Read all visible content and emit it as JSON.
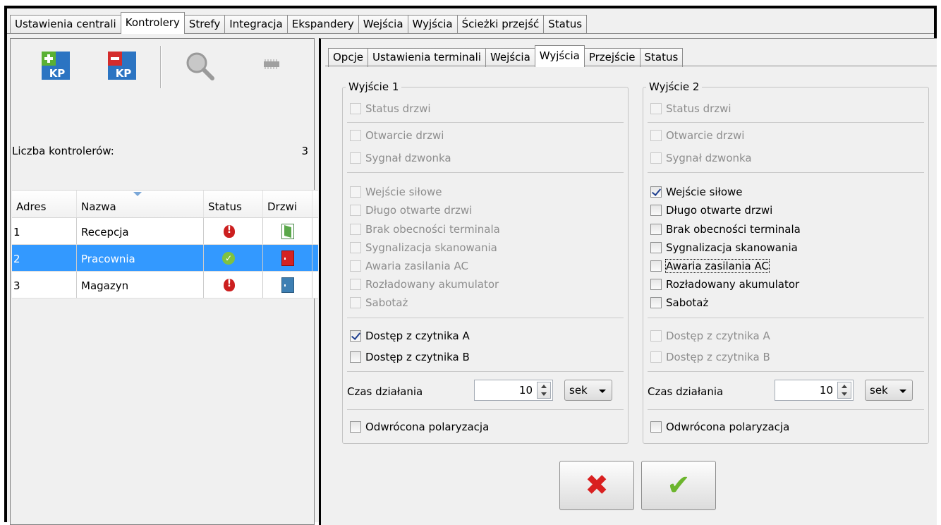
{
  "top_tabs": [
    {
      "label": "Ustawienia centrali",
      "active": false
    },
    {
      "label": "Kontrolery",
      "active": true
    },
    {
      "label": "Strefy",
      "active": false
    },
    {
      "label": "Integracja",
      "active": false
    },
    {
      "label": "Ekspandery",
      "active": false
    },
    {
      "label": "Wejścia",
      "active": false
    },
    {
      "label": "Wyjścia",
      "active": false
    },
    {
      "label": "Ścieżki przejść",
      "active": false
    },
    {
      "label": "Status",
      "active": false
    }
  ],
  "toolbar": {
    "add_kp_text": "KP",
    "remove_kp_text": "KP",
    "add_color": "#5ab033",
    "remove_color": "#d42c2c",
    "kp_bg": "#2b74c2"
  },
  "controllers": {
    "count_label": "Liczba kontrolerów:",
    "count_value": "3",
    "columns": [
      "Adres",
      "Nazwa",
      "Status",
      "Drzwi"
    ],
    "rows": [
      {
        "adres": "1",
        "nazwa": "Recepcja",
        "status": "error",
        "door": "open"
      },
      {
        "adres": "2",
        "nazwa": "Pracownia",
        "status": "ok",
        "door": "alarm"
      },
      {
        "adres": "3",
        "nazwa": "Magazyn",
        "status": "error",
        "door": "closed"
      }
    ],
    "selected_row": 1
  },
  "sub_tabs": [
    {
      "label": "Opcje",
      "active": false
    },
    {
      "label": "Ustawienia terminali",
      "active": false
    },
    {
      "label": "Wejścia",
      "active": false
    },
    {
      "label": "Wyjścia",
      "active": true
    },
    {
      "label": "Przejście",
      "active": false
    },
    {
      "label": "Status",
      "active": false
    }
  ],
  "outputs": [
    {
      "title": "Wyjście 1",
      "status_drzwi": {
        "label": "Status drzwi",
        "checked": false,
        "enabled": false
      },
      "otwarcie": {
        "label": "Otwarcie drzwi",
        "checked": false,
        "enabled": false
      },
      "sygnal": {
        "label": "Sygnał dzwonka",
        "checked": false,
        "enabled": false
      },
      "wejscie_silowe": {
        "label": "Wejście siłowe",
        "checked": false,
        "enabled": false
      },
      "dlugo_otwarte": {
        "label": "Długo otwarte drzwi",
        "checked": false,
        "enabled": false
      },
      "brak_terminala": {
        "label": "Brak obecności terminala",
        "checked": false,
        "enabled": false
      },
      "sygn_skan": {
        "label": "Sygnalizacja skanowania",
        "checked": false,
        "enabled": false
      },
      "awaria_ac": {
        "label": "Awaria zasilania AC",
        "checked": false,
        "enabled": false
      },
      "akumulator": {
        "label": "Rozładowany akumulator",
        "checked": false,
        "enabled": false
      },
      "sabotaz": {
        "label": "Sabotaż",
        "checked": false,
        "enabled": false
      },
      "czytnik_a": {
        "label": "Dostęp z czytnika A",
        "checked": true,
        "enabled": true
      },
      "czytnik_b": {
        "label": "Dostęp z czytnika B",
        "checked": false,
        "enabled": true
      },
      "czas_label": "Czas działania",
      "czas_value": "10",
      "unit": "sek",
      "polaryzacja": {
        "label": "Odwrócona polaryzacja",
        "checked": false,
        "enabled": true
      }
    },
    {
      "title": "Wyjście 2",
      "status_drzwi": {
        "label": "Status drzwi",
        "checked": false,
        "enabled": false
      },
      "otwarcie": {
        "label": "Otwarcie drzwi",
        "checked": false,
        "enabled": false
      },
      "sygnal": {
        "label": "Sygnał dzwonka",
        "checked": false,
        "enabled": false
      },
      "wejscie_silowe": {
        "label": "Wejście siłowe",
        "checked": true,
        "enabled": true
      },
      "dlugo_otwarte": {
        "label": "Długo otwarte drzwi",
        "checked": false,
        "enabled": true
      },
      "brak_terminala": {
        "label": "Brak obecności terminala",
        "checked": false,
        "enabled": true
      },
      "sygn_skan": {
        "label": "Sygnalizacja skanowania",
        "checked": false,
        "enabled": true
      },
      "awaria_ac": {
        "label": "Awaria zasilania AC",
        "checked": false,
        "enabled": true
      },
      "akumulator": {
        "label": "Rozładowany akumulator",
        "checked": false,
        "enabled": true
      },
      "sabotaz": {
        "label": "Sabotaż",
        "checked": false,
        "enabled": true
      },
      "czytnik_a": {
        "label": "Dostęp z czytnika A",
        "checked": false,
        "enabled": false
      },
      "czytnik_b": {
        "label": "Dostęp z czytnika B",
        "checked": false,
        "enabled": false
      },
      "czas_label": "Czas działania",
      "czas_value": "10",
      "unit": "sek",
      "polaryzacja": {
        "label": "Odwrócona polaryzacja",
        "checked": false,
        "enabled": true
      }
    }
  ],
  "buttons": {
    "cancel_icon": "✖",
    "ok_icon": "✔",
    "cancel_color": "#d92020",
    "ok_color": "#6cb52d"
  }
}
